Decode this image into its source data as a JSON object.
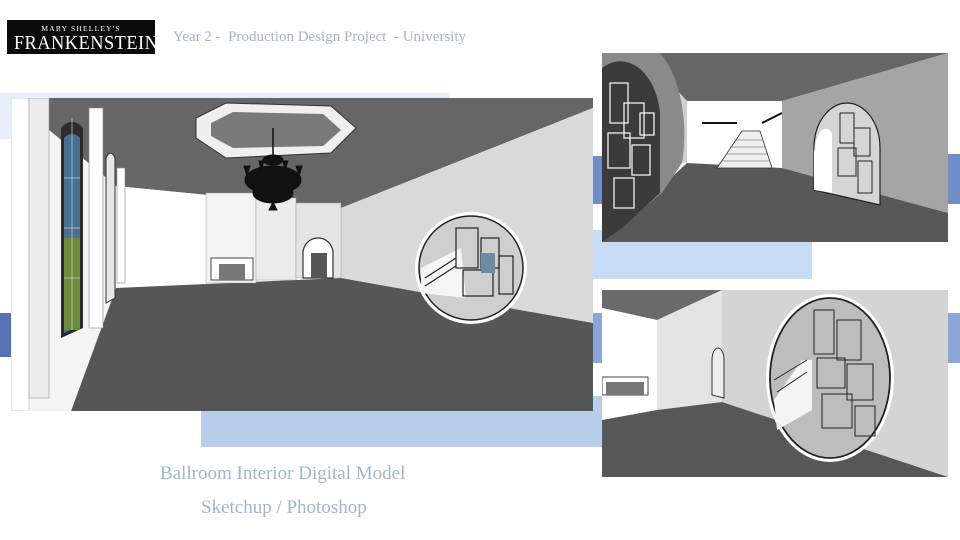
{
  "header": {
    "logo_line1": "MARY SHELLEY'S",
    "logo_line2": "FRANKENSTEIN",
    "subtitle": "Year 2 -  Production Design Project  - University"
  },
  "caption": {
    "title": "Ballroom Interior Digital Model",
    "tools": "Sketchup / Photoshop"
  },
  "colors": {
    "caption_text": "#9fb6cf",
    "band_light": "#e6eefb",
    "band_mid": "#c7dcf7",
    "band_blue": "#b7cdea",
    "band_dark": "#5673b6",
    "floor": "#555555",
    "ceiling": "#666666",
    "wall_light": "#d8d8d8",
    "wall_white": "#ffffff"
  },
  "renders": [
    {
      "view": "ballroom-main-view"
    },
    {
      "view": "staircase-archway-view"
    },
    {
      "view": "round-archway-view"
    }
  ]
}
